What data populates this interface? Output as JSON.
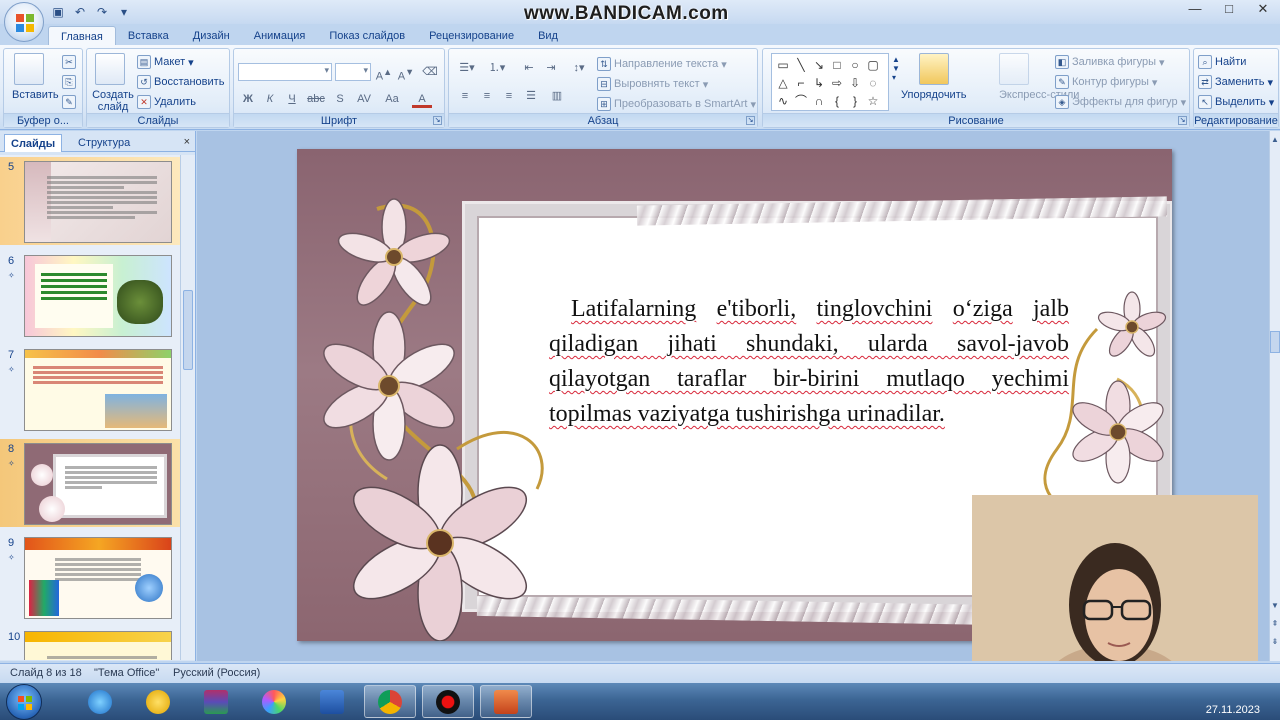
{
  "app": {
    "watermark": "www.BANDICAM.com",
    "window_controls": [
      "—",
      "□",
      "✕"
    ]
  },
  "tabs": [
    "Главная",
    "Вставка",
    "Дизайн",
    "Анимация",
    "Показ слайдов",
    "Рецензирование",
    "Вид"
  ],
  "ribbon": {
    "clipboard": {
      "label": "Буфер о...",
      "paste": "Вставить"
    },
    "slides": {
      "label": "Слайды",
      "new_slide": "Создать слайд",
      "layout": "Макет",
      "reset": "Восстановить",
      "delete": "Удалить"
    },
    "font": {
      "label": "Шрифт",
      "bold": "Ж",
      "italic": "К",
      "underline": "Ч",
      "strike": "abc",
      "shadow": "S",
      "spacing": "AV",
      "case": "Aa",
      "color": "A"
    },
    "paragraph": {
      "label": "Абзац",
      "text_direction": "Направление текста",
      "align_text": "Выровнять текст",
      "convert_smartart": "Преобразовать в SmartArt"
    },
    "drawing": {
      "label": "Рисование",
      "arrange": "Упорядочить",
      "quick_styles": "Экспресс-стили",
      "shape_fill": "Заливка фигуры",
      "shape_outline": "Контур фигуры",
      "shape_effects": "Эффекты для фигур"
    },
    "editing": {
      "label": "Редактирование",
      "find": "Найти",
      "replace": "Заменить",
      "select": "Выделить"
    }
  },
  "panel": {
    "tab_slides": "Слайды",
    "tab_outline": "Структура",
    "close": "×",
    "thumbnails": [
      {
        "num": "5"
      },
      {
        "num": "6"
      },
      {
        "num": "7"
      },
      {
        "num": "8"
      },
      {
        "num": "9"
      },
      {
        "num": "10"
      }
    ]
  },
  "slide": {
    "text_line1": "Latifalarning",
    "text_line2": "e'tiborli,",
    "text_line3": "tinglovchini",
    "text_line4": "o‘ziga",
    "text_rest": "jalb qiladigan jihati shundaki, ularda savol-javob qilayotgan taraflar bir-birini mutlaqo yechimi topilmas vaziyatga tushirishga urinadilar."
  },
  "status": {
    "slide_info": "Слайд 8 из 18",
    "theme": "\"Тема Office\"",
    "language": "Русский (Россия)"
  },
  "taskbar": {
    "date": "27.11.2023"
  }
}
